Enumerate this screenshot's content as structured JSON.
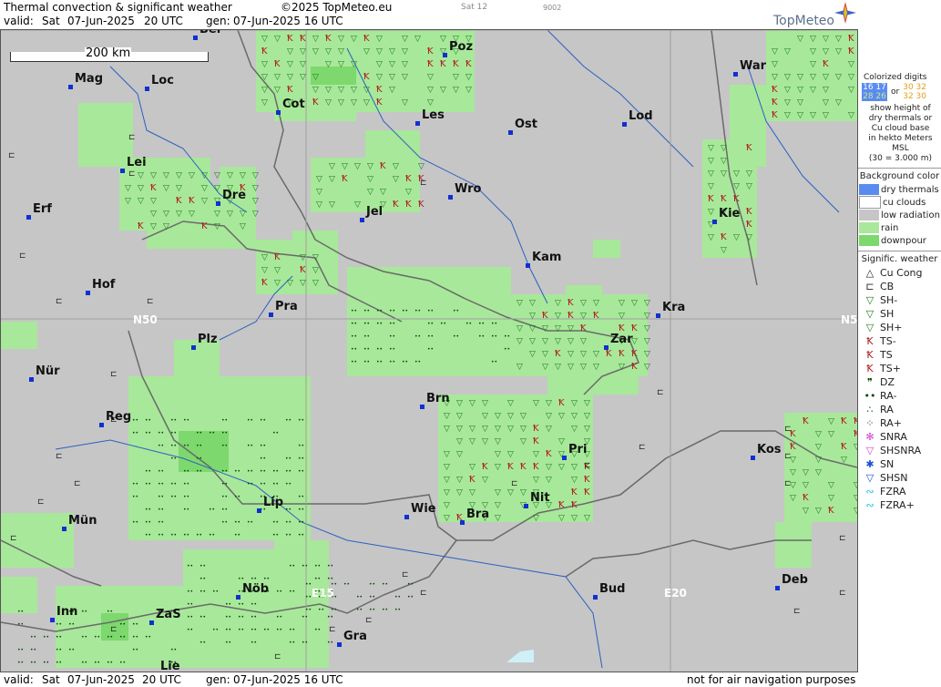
{
  "header": {
    "title": "Thermal convection & significant weather",
    "copyright": "©2025 TopMeteo.eu",
    "day_code": "Sat 12",
    "number": "9002",
    "valid_label": "valid:",
    "valid_day": "Sat",
    "valid_date": "07-Jun-2025",
    "valid_time": "20 UTC",
    "gen_label": "gen:",
    "gen_value": "07-Jun-2025 16 UTC",
    "brand": "TopMeteo"
  },
  "map": {
    "scale_label": "200 km",
    "grid_labels": [
      "N50",
      "N5",
      "E15",
      "E20"
    ],
    "cities": [
      "Ber",
      "Mag",
      "Loc",
      "Cot",
      "Poz",
      "Les",
      "Lod",
      "War",
      "Ost",
      "Lei",
      "Dre",
      "Wro",
      "Erf",
      "Jel",
      "Kie",
      "Kam",
      "Hof",
      "Pra",
      "Kra",
      "Zar",
      "Plz",
      "Nür",
      "Brn",
      "Reg",
      "Pri",
      "Kos",
      "Lip",
      "Nit",
      "Mün",
      "Wie",
      "Bra",
      "Deb",
      "Nöb",
      "Bud",
      "Inn",
      "ZaS",
      "Gra",
      "Lie"
    ],
    "colors": {
      "rain": "#a8e89a",
      "downpour": "#7dd86e",
      "land": "#c6c6c6",
      "sh_symbol": "#1a7a1a",
      "ts_symbol": "#b02020",
      "ra_symbol": "#0a4a0a"
    }
  },
  "legend": {
    "title_lines": [
      "Colorized digits"
    ],
    "digits_a": "16 17",
    "digits_b": "28 26",
    "or": "or",
    "digits_c": "30 32",
    "digits_d": "32 30",
    "desc": [
      "show height of",
      "dry thermals or",
      "Cu cloud base",
      "in hekto Meters",
      "MSL",
      "(30 = 3.000 m)"
    ],
    "bg_title": "Background color",
    "backgrounds": [
      {
        "label": "dry thermals",
        "color": "#5a8cf0"
      },
      {
        "label": "cu clouds",
        "color": "#ffffff"
      },
      {
        "label": "low radiation",
        "color": "#c6c6c6"
      },
      {
        "label": "rain",
        "color": "#a8e89a"
      },
      {
        "label": "downpour",
        "color": "#7dd86e"
      }
    ],
    "sig_title": "Signific. weather",
    "symbols": [
      {
        "label": "Cu Cong",
        "icon": "cu-cong-icon",
        "glyph": "△",
        "color": "#222"
      },
      {
        "label": "CB",
        "icon": "cb-icon",
        "glyph": "⊏",
        "color": "#222"
      },
      {
        "label": "SH-",
        "icon": "shower-light-icon",
        "glyph": "▽",
        "color": "#1a7a1a"
      },
      {
        "label": "SH",
        "icon": "shower-icon",
        "glyph": "▽",
        "color": "#1a7a1a"
      },
      {
        "label": "SH+",
        "icon": "shower-heavy-icon",
        "glyph": "▽",
        "color": "#1a7a1a"
      },
      {
        "label": "TS-",
        "icon": "thunderstorm-light-icon",
        "glyph": "Ꝁ",
        "color": "#b02020"
      },
      {
        "label": "TS",
        "icon": "thunderstorm-icon",
        "glyph": "Ꝁ",
        "color": "#b02020"
      },
      {
        "label": "TS+",
        "icon": "thunderstorm-heavy-icon",
        "glyph": "Ꝁ",
        "color": "#b02020"
      },
      {
        "label": "DZ",
        "icon": "drizzle-icon",
        "glyph": "❞",
        "color": "#0a4a0a"
      },
      {
        "label": "RA-",
        "icon": "rain-light-icon",
        "glyph": "••",
        "color": "#0a4a0a"
      },
      {
        "label": "RA",
        "icon": "rain-icon",
        "glyph": "∴",
        "color": "#0a4a0a"
      },
      {
        "label": "RA+",
        "icon": "rain-heavy-icon",
        "glyph": "⁘",
        "color": "#0a4a0a"
      },
      {
        "label": "SNRA",
        "icon": "snow-rain-icon",
        "glyph": "✻",
        "color": "#d040d0"
      },
      {
        "label": "SHSNRA",
        "icon": "snow-rain-shower-icon",
        "glyph": "▽",
        "color": "#d040d0"
      },
      {
        "label": "SN",
        "icon": "snow-icon",
        "glyph": "✱",
        "color": "#2050d0"
      },
      {
        "label": "SHSN",
        "icon": "snow-shower-icon",
        "glyph": "▽",
        "color": "#2050d0"
      },
      {
        "label": "FZRA",
        "icon": "freezing-rain-icon",
        "glyph": "∾",
        "color": "#20c0e0"
      },
      {
        "label": "FZRA+",
        "icon": "freezing-rain-heavy-icon",
        "glyph": "∾",
        "color": "#20c0e0"
      }
    ]
  },
  "footer": {
    "valid_label": "valid:",
    "valid_day": "Sat",
    "valid_date": "07-Jun-2025",
    "valid_time": "20 UTC",
    "gen_label": "gen:",
    "gen_value": "07-Jun-2025 16 UTC",
    "disclaimer": "not for air navigation purposes"
  }
}
